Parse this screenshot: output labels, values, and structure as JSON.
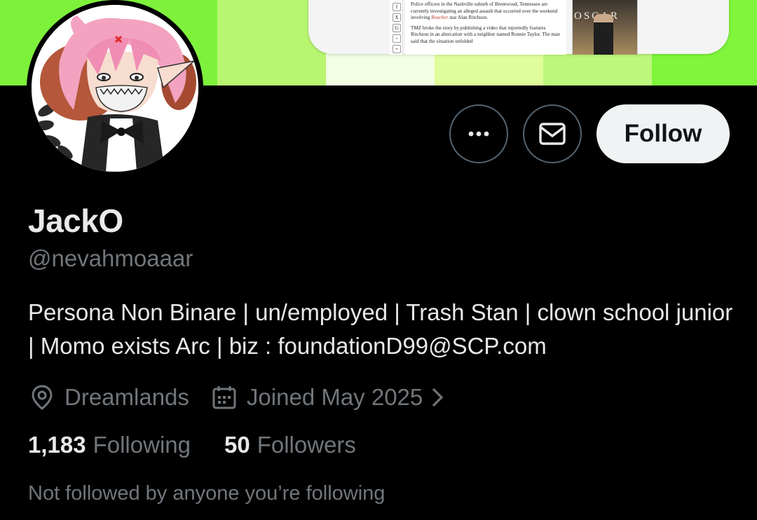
{
  "banner": {
    "article": {
      "share_icons": [
        "f",
        "X",
        "G",
        "▫",
        "+"
      ],
      "paragraphs": [
        {
          "text": "Police officers in the Nashville suburb of Brentwood, Tennessee are currently investigating an alleged assault that occurred over the weekend involving ",
          "italic": "Reacher",
          "tail": " star Alan Ritchson."
        },
        {
          "text": "TMZ broke the story by publishing a video that reportedly features Ritchson in an altercation with a neighbor named Ronnie Taylor. The man said that the situation unfolded"
        }
      ],
      "thumb_title": "OSCAR"
    }
  },
  "profile": {
    "display_name": "JackO",
    "handle": "@nevahmoaaar",
    "bio": "Persona Non Binare | un/employed | Trash Stan | clown school junior | Momo exists Arc | biz : foundationD99@SCP.com",
    "location": "Dreamlands",
    "joined": "Joined May 2025",
    "following_count": "1,183",
    "following_label": "Following",
    "followers_count": "50",
    "followers_label": "Followers",
    "not_followed_text": "Not followed by anyone you’re following"
  },
  "actions": {
    "more_icon": "more-horizontal-icon",
    "message_icon": "envelope-icon",
    "follow_label": "Follow"
  },
  "colors": {
    "background": "#000000",
    "primary_text": "#e7e9ea",
    "secondary_text": "#71767b",
    "button_border": "#536471",
    "follow_bg": "#eff3f4",
    "banner_green": "#7ef23b"
  }
}
